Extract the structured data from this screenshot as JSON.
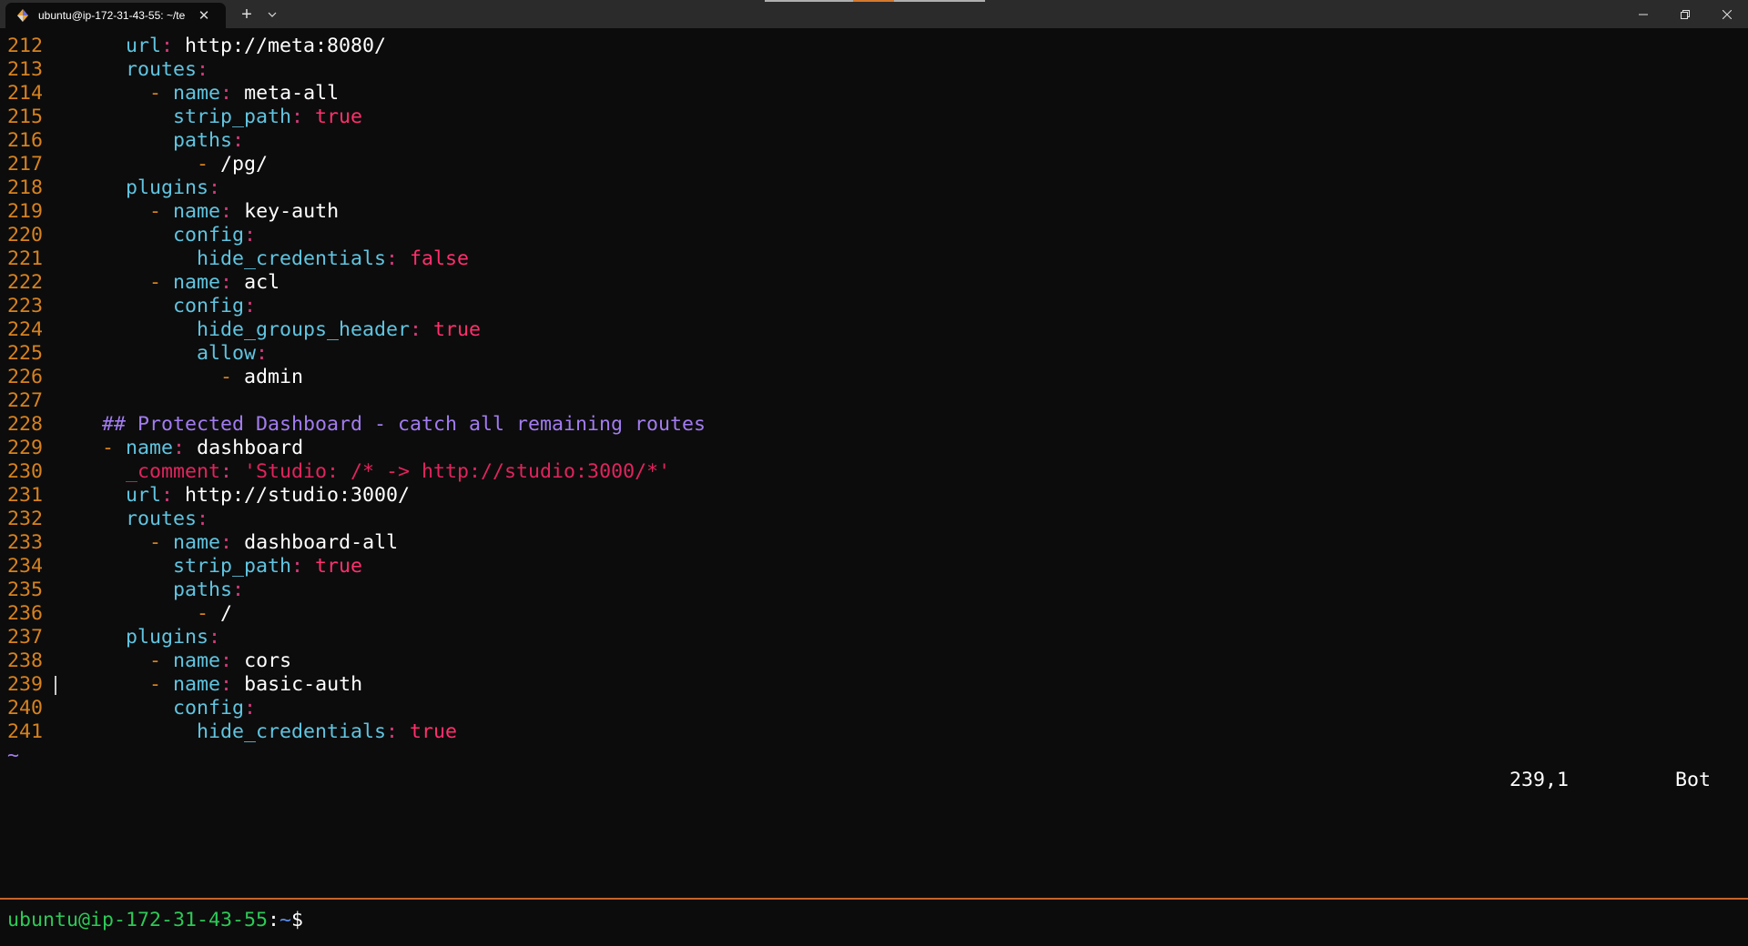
{
  "window": {
    "tab_title": "ubuntu@ip-172-31-43-55: ~/te",
    "tab_icon": "linux-penguin-icon",
    "new_tab_symbol": "+",
    "close_symbol": "✕"
  },
  "editor": {
    "lines": [
      {
        "n": "212",
        "i": "    ",
        "segs": [
          {
            "t": "url",
            "c": "k"
          },
          {
            "t": ": ",
            "c": "c"
          },
          {
            "t": "http://meta:8080/",
            "c": "v"
          }
        ]
      },
      {
        "n": "213",
        "i": "    ",
        "segs": [
          {
            "t": "routes",
            "c": "k"
          },
          {
            "t": ":",
            "c": "c"
          }
        ]
      },
      {
        "n": "214",
        "i": "      ",
        "segs": [
          {
            "t": "- ",
            "c": "d"
          },
          {
            "t": "name",
            "c": "k"
          },
          {
            "t": ": ",
            "c": "c"
          },
          {
            "t": "meta-all",
            "c": "v"
          }
        ]
      },
      {
        "n": "215",
        "i": "        ",
        "segs": [
          {
            "t": "strip_path",
            "c": "k"
          },
          {
            "t": ": ",
            "c": "c"
          },
          {
            "t": "true",
            "c": "b"
          }
        ]
      },
      {
        "n": "216",
        "i": "        ",
        "segs": [
          {
            "t": "paths",
            "c": "k"
          },
          {
            "t": ":",
            "c": "c"
          }
        ]
      },
      {
        "n": "217",
        "i": "          ",
        "segs": [
          {
            "t": "- ",
            "c": "d"
          },
          {
            "t": "/pg/",
            "c": "v"
          }
        ]
      },
      {
        "n": "218",
        "i": "    ",
        "segs": [
          {
            "t": "plugins",
            "c": "k"
          },
          {
            "t": ":",
            "c": "c"
          }
        ]
      },
      {
        "n": "219",
        "i": "      ",
        "segs": [
          {
            "t": "- ",
            "c": "d"
          },
          {
            "t": "name",
            "c": "k"
          },
          {
            "t": ": ",
            "c": "c"
          },
          {
            "t": "key-auth",
            "c": "v"
          }
        ]
      },
      {
        "n": "220",
        "i": "        ",
        "segs": [
          {
            "t": "config",
            "c": "k"
          },
          {
            "t": ":",
            "c": "c"
          }
        ]
      },
      {
        "n": "221",
        "i": "          ",
        "segs": [
          {
            "t": "hide_credentials",
            "c": "k"
          },
          {
            "t": ": ",
            "c": "c"
          },
          {
            "t": "false",
            "c": "b"
          }
        ]
      },
      {
        "n": "222",
        "i": "      ",
        "segs": [
          {
            "t": "- ",
            "c": "d"
          },
          {
            "t": "name",
            "c": "k"
          },
          {
            "t": ": ",
            "c": "c"
          },
          {
            "t": "acl",
            "c": "v"
          }
        ]
      },
      {
        "n": "223",
        "i": "        ",
        "segs": [
          {
            "t": "config",
            "c": "k"
          },
          {
            "t": ":",
            "c": "c"
          }
        ]
      },
      {
        "n": "224",
        "i": "          ",
        "segs": [
          {
            "t": "hide_groups_header",
            "c": "k"
          },
          {
            "t": ": ",
            "c": "c"
          },
          {
            "t": "true",
            "c": "b"
          }
        ]
      },
      {
        "n": "225",
        "i": "          ",
        "segs": [
          {
            "t": "allow",
            "c": "k"
          },
          {
            "t": ":",
            "c": "c"
          }
        ]
      },
      {
        "n": "226",
        "i": "            ",
        "segs": [
          {
            "t": "- ",
            "c": "d"
          },
          {
            "t": "admin",
            "c": "v"
          }
        ]
      },
      {
        "n": "227",
        "i": "",
        "segs": []
      },
      {
        "n": "228",
        "i": "  ",
        "segs": [
          {
            "t": "## Protected Dashboard - catch all remaining routes",
            "c": "cm"
          }
        ]
      },
      {
        "n": "229",
        "i": "  ",
        "segs": [
          {
            "t": "- ",
            "c": "d"
          },
          {
            "t": "name",
            "c": "k"
          },
          {
            "t": ": ",
            "c": "c"
          },
          {
            "t": "dashboard",
            "c": "v"
          }
        ]
      },
      {
        "n": "230",
        "i": "    ",
        "segs": [
          {
            "t": "_comment",
            "c": "s"
          },
          {
            "t": ": ",
            "c": "c"
          },
          {
            "t": "'Studio: /* -> http://studio:3000/*'",
            "c": "s"
          }
        ]
      },
      {
        "n": "231",
        "i": "    ",
        "segs": [
          {
            "t": "url",
            "c": "k"
          },
          {
            "t": ": ",
            "c": "c"
          },
          {
            "t": "http://studio:3000/",
            "c": "v"
          }
        ]
      },
      {
        "n": "232",
        "i": "    ",
        "segs": [
          {
            "t": "routes",
            "c": "k"
          },
          {
            "t": ":",
            "c": "c"
          }
        ]
      },
      {
        "n": "233",
        "i": "      ",
        "segs": [
          {
            "t": "- ",
            "c": "d"
          },
          {
            "t": "name",
            "c": "k"
          },
          {
            "t": ": ",
            "c": "c"
          },
          {
            "t": "dashboard-all",
            "c": "v"
          }
        ]
      },
      {
        "n": "234",
        "i": "        ",
        "segs": [
          {
            "t": "strip_path",
            "c": "k"
          },
          {
            "t": ": ",
            "c": "c"
          },
          {
            "t": "true",
            "c": "b"
          }
        ]
      },
      {
        "n": "235",
        "i": "        ",
        "segs": [
          {
            "t": "paths",
            "c": "k"
          },
          {
            "t": ":",
            "c": "c"
          }
        ]
      },
      {
        "n": "236",
        "i": "          ",
        "segs": [
          {
            "t": "- ",
            "c": "d"
          },
          {
            "t": "/",
            "c": "v"
          }
        ]
      },
      {
        "n": "237",
        "i": "    ",
        "segs": [
          {
            "t": "plugins",
            "c": "k"
          },
          {
            "t": ":",
            "c": "c"
          }
        ]
      },
      {
        "n": "238",
        "i": "      ",
        "segs": [
          {
            "t": "- ",
            "c": "d"
          },
          {
            "t": "name",
            "c": "k"
          },
          {
            "t": ": ",
            "c": "c"
          },
          {
            "t": "cors",
            "c": "v"
          }
        ]
      },
      {
        "n": "239",
        "i": "      ",
        "segs": [
          {
            "t": "- ",
            "c": "d"
          },
          {
            "t": "name",
            "c": "k"
          },
          {
            "t": ": ",
            "c": "c"
          },
          {
            "t": "basic-auth",
            "c": "v"
          }
        ],
        "cursor": true
      },
      {
        "n": "240",
        "i": "        ",
        "segs": [
          {
            "t": "config",
            "c": "k"
          },
          {
            "t": ":",
            "c": "c"
          }
        ]
      },
      {
        "n": "241",
        "i": "          ",
        "segs": [
          {
            "t": "hide_credentials",
            "c": "k"
          },
          {
            "t": ": ",
            "c": "c"
          },
          {
            "t": "true",
            "c": "b"
          }
        ]
      }
    ],
    "tilde": "~",
    "ruler_position": "239,1",
    "ruler_percent": "Bot"
  },
  "prompt": {
    "user_host": "ubuntu@ip-172-31-43-55",
    "colon": ":",
    "path": "~",
    "symbol": "$"
  }
}
